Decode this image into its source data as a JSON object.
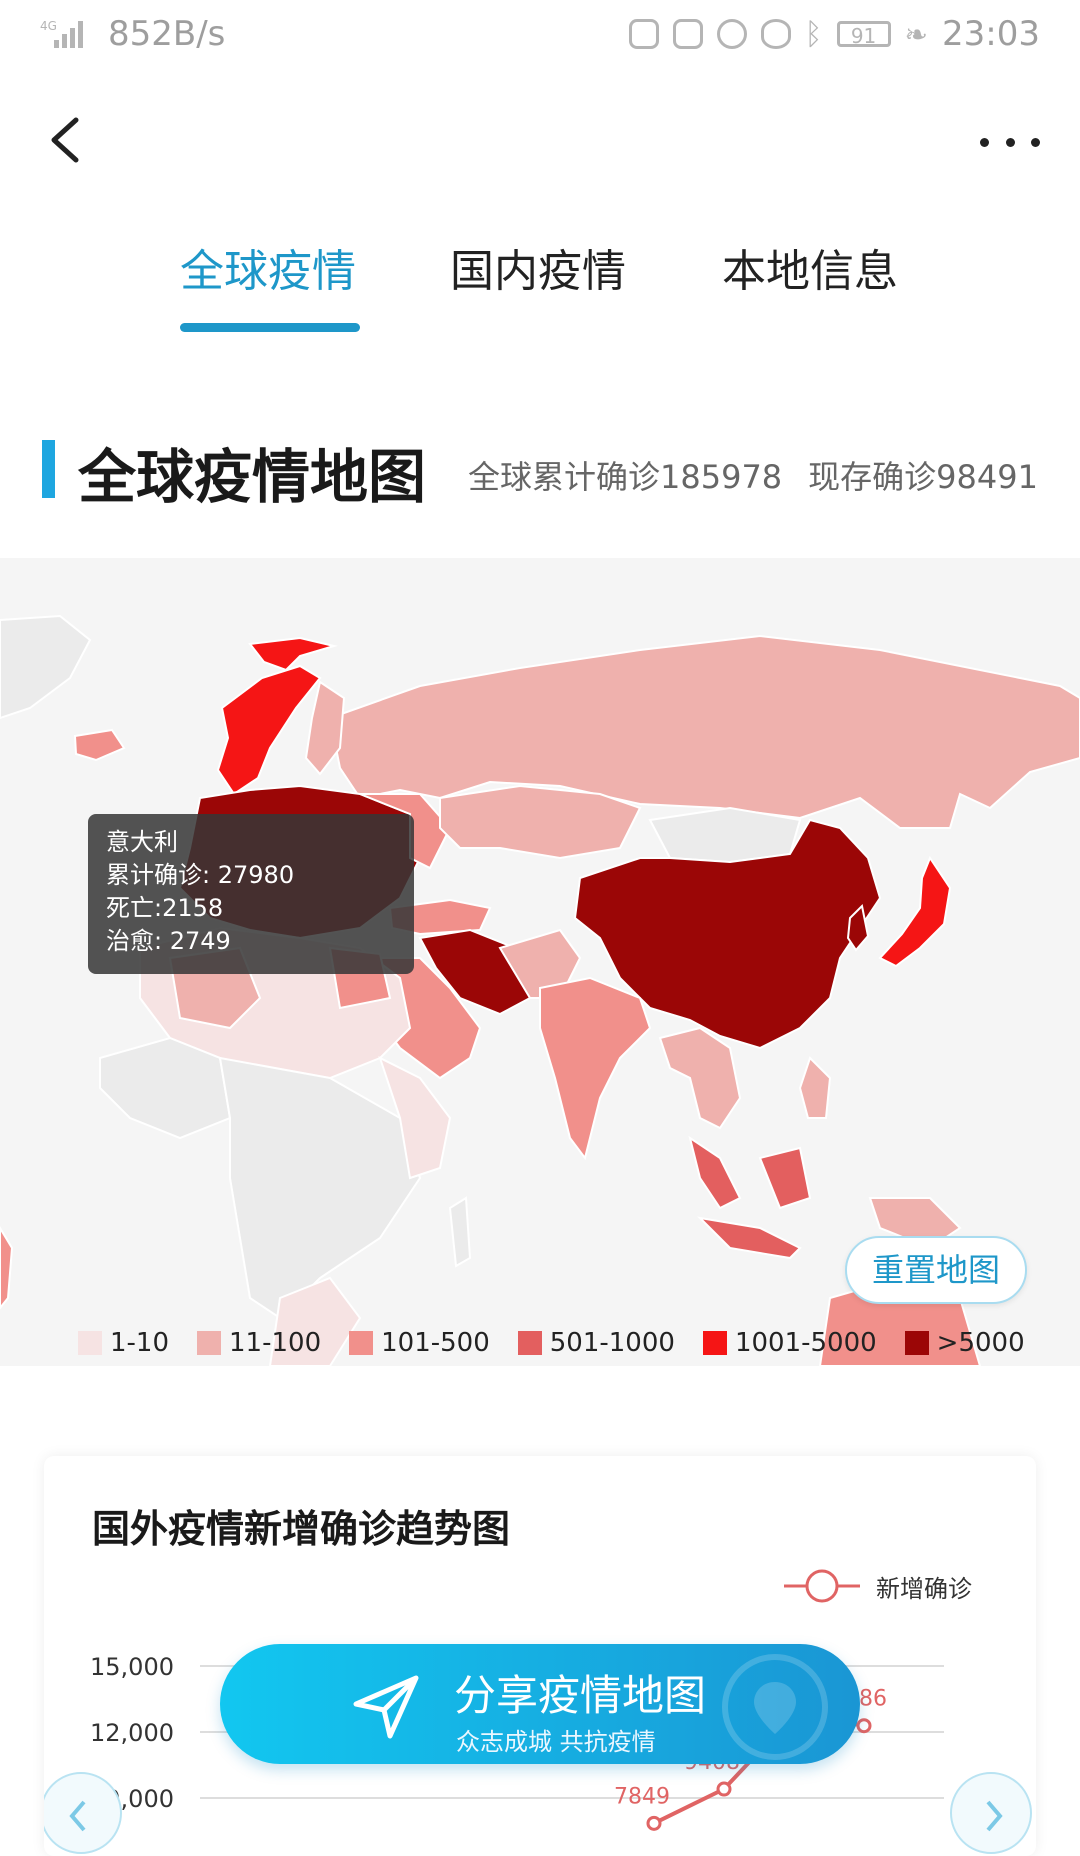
{
  "status_bar": {
    "network": "4G",
    "speed": "852B/s",
    "battery": "91",
    "time": "23:03"
  },
  "nav": {
    "back_icon": "chevron-left-icon",
    "more_icon": "more-horizontal-icon"
  },
  "tabs": [
    {
      "label": "全球疫情",
      "active": true
    },
    {
      "label": "国内疫情",
      "active": false
    },
    {
      "label": "本地信息",
      "active": false
    }
  ],
  "section": {
    "title": "全球疫情地图",
    "total_confirmed": "全球累计确诊185978",
    "current_confirmed": "现存确诊98491"
  },
  "map": {
    "tooltip": {
      "country": "意大利",
      "confirmed_label": "累计确诊:",
      "confirmed_value": "27980",
      "deaths_label": "死亡:",
      "deaths_value": "2158",
      "recovered_label": "治愈:",
      "recovered_value": "2749"
    },
    "reset_button": "重置地图",
    "legend": [
      {
        "label": "1-10",
        "color": "#f6e3e3"
      },
      {
        "label": "11-100",
        "color": "#efb1ad"
      },
      {
        "label": "101-500",
        "color": "#f1908b"
      },
      {
        "label": "501-1000",
        "color": "#e35f5f"
      },
      {
        "label": "1001-5000",
        "color": "#f51515"
      },
      {
        "label": ">5000",
        "color": "#9b0606"
      }
    ]
  },
  "trend": {
    "title": "国外疫情新增确诊趋势图",
    "legend_label": "新增确诊",
    "series_color": "#e06464",
    "y_ticks": [
      "15,000",
      "12,000",
      "9,000"
    ],
    "point_labels": [
      "7849",
      "9408",
      "792",
      "12286"
    ],
    "chart_data": {
      "type": "line",
      "series": [
        {
          "name": "新增确诊",
          "values": [
            7849,
            9408,
            12792,
            12286
          ]
        }
      ],
      "ylim": [
        9000,
        15000
      ]
    }
  },
  "share_button": {
    "icon": "send-icon",
    "label": "分享疫情地图",
    "sub_label": "众志成城 共抗疫情"
  }
}
